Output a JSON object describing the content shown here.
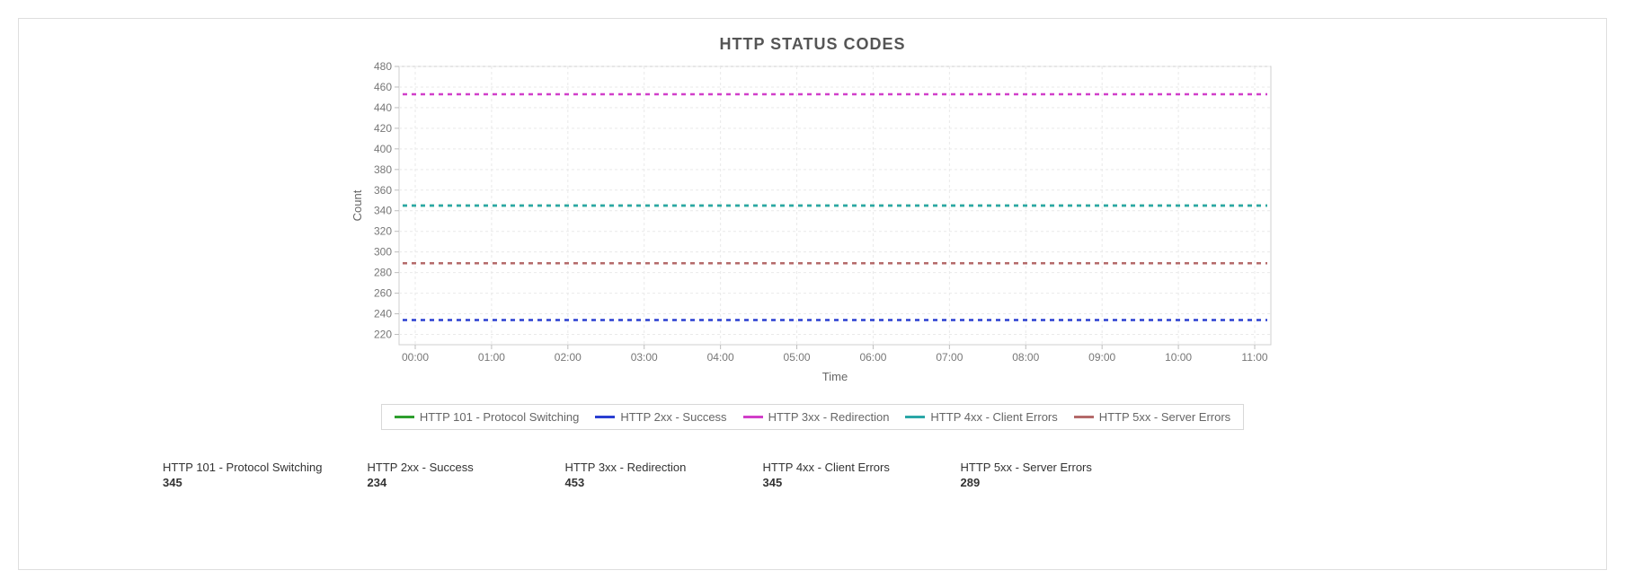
{
  "chart_data": {
    "type": "line",
    "title": "HTTP STATUS CODES",
    "xlabel": "Time",
    "ylabel": "Count",
    "ylim": [
      210,
      480
    ],
    "x_ticks": [
      "00:00",
      "01:00",
      "02:00",
      "03:00",
      "04:00",
      "05:00",
      "06:00",
      "07:00",
      "08:00",
      "09:00",
      "10:00",
      "11:00"
    ],
    "y_ticks": [
      220,
      240,
      260,
      280,
      300,
      320,
      340,
      360,
      380,
      400,
      420,
      440,
      460,
      480
    ],
    "categories": [
      "00:00",
      "01:00",
      "02:00",
      "03:00",
      "04:00",
      "05:00",
      "06:00",
      "07:00",
      "08:00",
      "09:00",
      "10:00",
      "11:00"
    ],
    "series": [
      {
        "name": "HTTP 101 - Protocol Switching",
        "color": "#2e9e2e",
        "values": [
          345,
          345,
          345,
          345,
          345,
          345,
          345,
          345,
          345,
          345,
          345,
          345
        ]
      },
      {
        "name": "HTTP 2xx - Success",
        "color": "#2a3fd1",
        "values": [
          234,
          234,
          234,
          234,
          234,
          234,
          234,
          234,
          234,
          234,
          234,
          234
        ]
      },
      {
        "name": "HTTP 3xx - Redirection",
        "color": "#d13fc9",
        "values": [
          453,
          453,
          453,
          453,
          453,
          453,
          453,
          453,
          453,
          453,
          453,
          453
        ]
      },
      {
        "name": "HTTP 4xx - Client Errors",
        "color": "#2aa7a7",
        "values": [
          345,
          345,
          345,
          345,
          345,
          345,
          345,
          345,
          345,
          345,
          345,
          345
        ]
      },
      {
        "name": "HTTP 5xx - Server Errors",
        "color": "#b46a6a",
        "values": [
          289,
          289,
          289,
          289,
          289,
          289,
          289,
          289,
          289,
          289,
          289,
          289
        ]
      }
    ]
  },
  "summary": [
    {
      "label": "HTTP 101 - Protocol Switching",
      "value": "345"
    },
    {
      "label": "HTTP 2xx - Success",
      "value": "234"
    },
    {
      "label": "HTTP 3xx - Redirection",
      "value": "453"
    },
    {
      "label": "HTTP 4xx - Client Errors",
      "value": "345"
    },
    {
      "label": "HTTP 5xx - Server Errors",
      "value": "289"
    }
  ]
}
